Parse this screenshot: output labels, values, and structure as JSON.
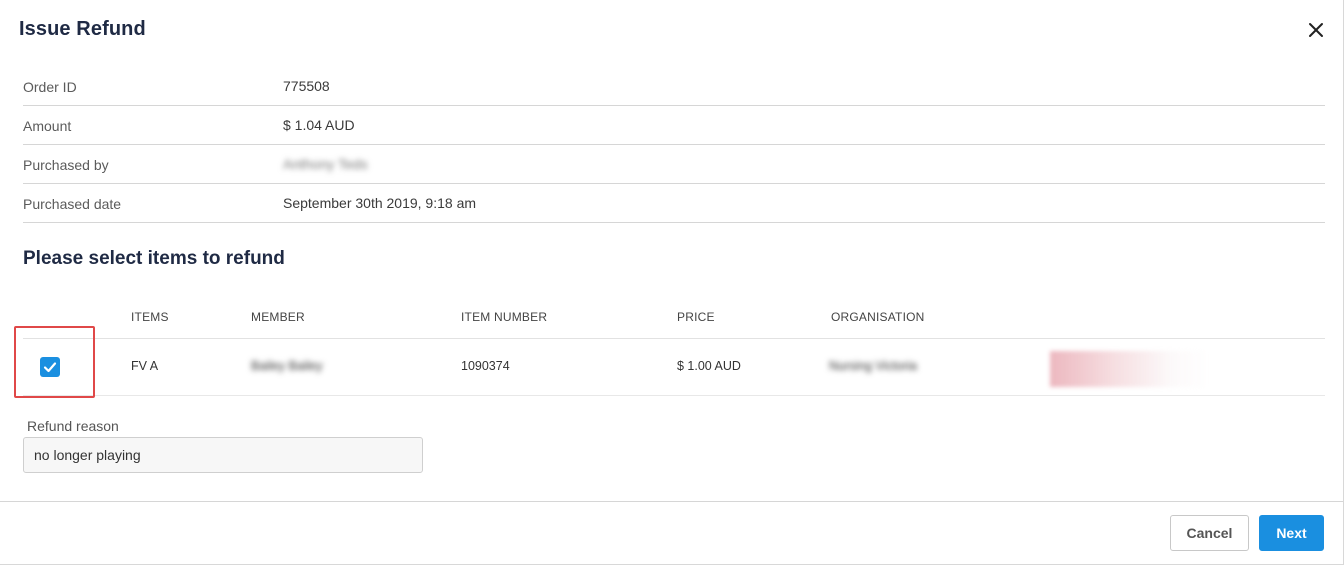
{
  "dialog": {
    "title": "Issue Refund",
    "close_icon": "close-icon"
  },
  "order_info": [
    {
      "label": "Order ID",
      "value": "775508"
    },
    {
      "label": "Amount",
      "value": "$ 1.04 AUD"
    },
    {
      "label": "Purchased by",
      "value": "Anthony Teds"
    },
    {
      "label": "Purchased date",
      "value": "September 30th 2019, 9:18 am"
    }
  ],
  "items_section": {
    "heading": "Please select items to refund",
    "columns": [
      "ITEMS",
      "MEMBER",
      "ITEM NUMBER",
      "PRICE",
      "ORGANISATION"
    ],
    "rows": [
      {
        "checked": true,
        "item": "FV A",
        "member": "Bailey Bailey",
        "item_number": "1090374",
        "price": "$ 1.00 AUD",
        "organisation": "Nursing Victoria"
      }
    ]
  },
  "refund_reason": {
    "label": "Refund reason",
    "value": "no longer playing"
  },
  "footer": {
    "cancel_label": "Cancel",
    "next_label": "Next"
  },
  "colors": {
    "accent": "#1a8fe0",
    "highlight": "#e04848",
    "title": "#1f2a44"
  }
}
